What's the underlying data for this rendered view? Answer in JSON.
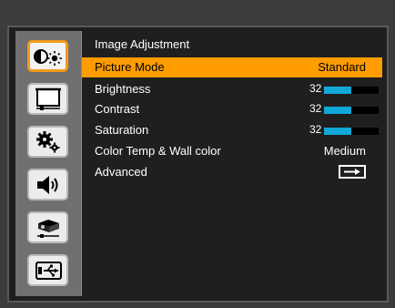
{
  "menu": {
    "title": "Image Adjustment",
    "rows": [
      {
        "label": "Picture Mode",
        "value": "Standard",
        "selected": true
      },
      {
        "label": "Brightness",
        "value": "32",
        "level": 0.5
      },
      {
        "label": "Contrast",
        "value": "32",
        "level": 0.5
      },
      {
        "label": "Saturation",
        "value": "32",
        "level": 0.5
      },
      {
        "label": "Color Temp & Wall color",
        "value": "Medium"
      },
      {
        "label": "Advanced",
        "value_icon": "enter-arrow-icon"
      }
    ]
  },
  "sidebar": {
    "items": [
      {
        "icon": "brightness-contrast-icon",
        "active": true
      },
      {
        "icon": "screen-icon"
      },
      {
        "icon": "settings-gears-icon"
      },
      {
        "icon": "speaker-icon"
      },
      {
        "icon": "projector-icon"
      },
      {
        "icon": "usb-icon"
      }
    ]
  },
  "colors": {
    "highlight": "#ff9c00",
    "slider_fill": "#10a8d8",
    "active_border": "#f39a1f"
  }
}
